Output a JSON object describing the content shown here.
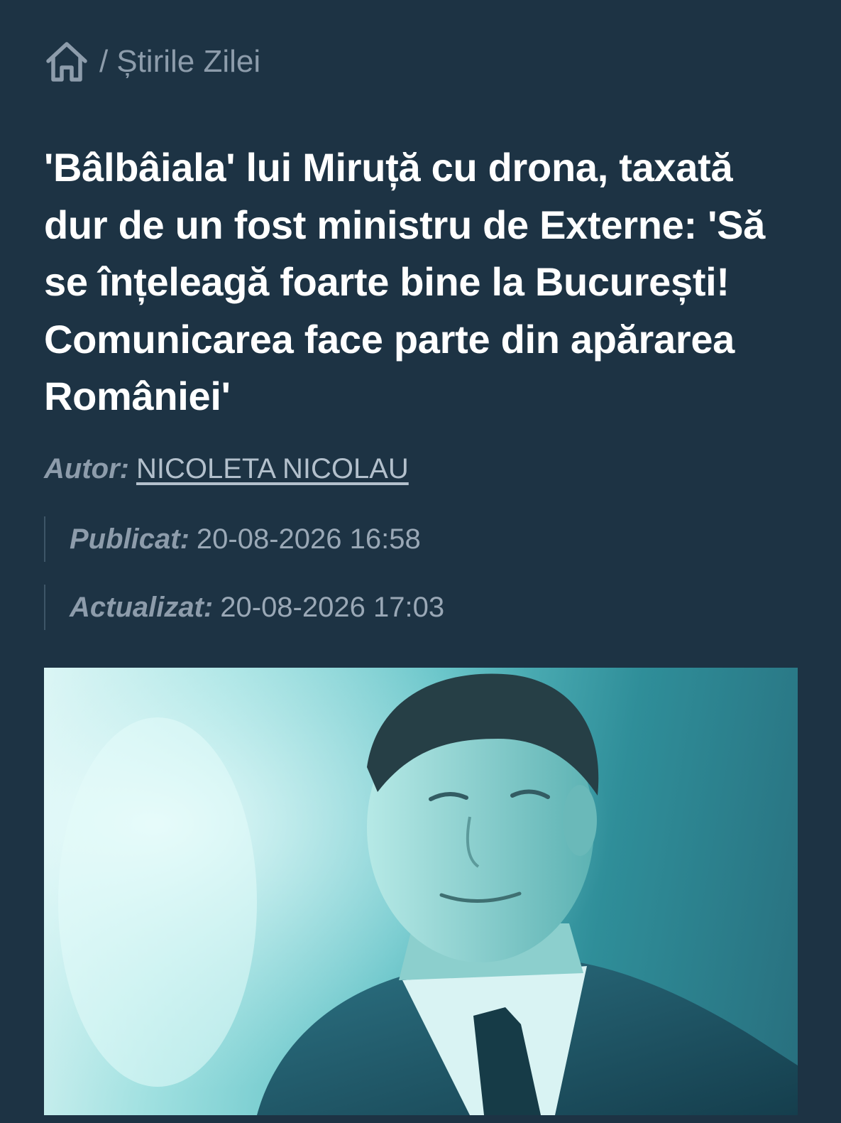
{
  "breadcrumb": {
    "home_icon": "home-icon",
    "separator": "/",
    "current": "Știrile Zilei"
  },
  "article": {
    "title": "'Bâlbâiala' lui Miruță cu drona, taxată dur de un fost ministru de Externe: 'Să se înțeleagă foarte bine la București! Comunicarea face parte din apărarea României'",
    "author_label": "Autor:",
    "author_name": "NICOLETA NICOLAU",
    "published_label": "Publicat:",
    "published_value": "20-08-2026 16:58",
    "updated_label": "Actualizat:",
    "updated_value": "20-08-2026 17:03"
  },
  "colors": {
    "background": "#1d3344",
    "title": "#ffffff",
    "muted": "#8d9cab"
  }
}
